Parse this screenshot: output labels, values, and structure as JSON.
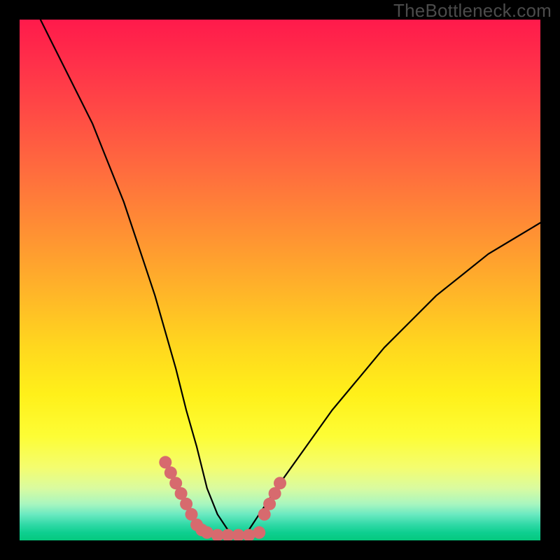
{
  "watermark": "TheBottleneck.com",
  "chart_data": {
    "type": "line",
    "title": "",
    "xlabel": "",
    "ylabel": "",
    "xlim": [
      0,
      100
    ],
    "ylim": [
      0,
      100
    ],
    "series": [
      {
        "name": "bottleneck-curve",
        "x": [
          4,
          6,
          8,
          10,
          12,
          14,
          16,
          18,
          20,
          22,
          24,
          26,
          28,
          30,
          32,
          34,
          36,
          38,
          40,
          42,
          44,
          46,
          50,
          55,
          60,
          65,
          70,
          75,
          80,
          85,
          90,
          95,
          100
        ],
        "y": [
          100,
          96,
          92,
          88,
          84,
          80,
          75,
          70,
          65,
          59,
          53,
          47,
          40,
          33,
          25,
          18,
          10,
          5,
          2,
          1,
          2,
          5,
          11,
          18,
          25,
          31,
          37,
          42,
          47,
          51,
          55,
          58,
          61
        ]
      },
      {
        "name": "highlight-left",
        "x": [
          28,
          29,
          30,
          31,
          32,
          33,
          34,
          35
        ],
        "y": [
          15,
          13,
          11,
          9,
          7,
          5,
          3,
          2
        ]
      },
      {
        "name": "highlight-bottom",
        "x": [
          36,
          38,
          40,
          42,
          44,
          46
        ],
        "y": [
          1.5,
          1,
          1,
          1,
          1,
          1.5
        ]
      },
      {
        "name": "highlight-right",
        "x": [
          47,
          48,
          49,
          50
        ],
        "y": [
          5,
          7,
          9,
          11
        ]
      }
    ],
    "background_gradient": {
      "type": "vertical",
      "stops": [
        {
          "pos": 0,
          "color": "#ff1a4b"
        },
        {
          "pos": 50,
          "color": "#ffb728"
        },
        {
          "pos": 80,
          "color": "#fdfd35"
        },
        {
          "pos": 100,
          "color": "#05c97e"
        }
      ]
    },
    "highlight_color": "#d76a6e"
  }
}
